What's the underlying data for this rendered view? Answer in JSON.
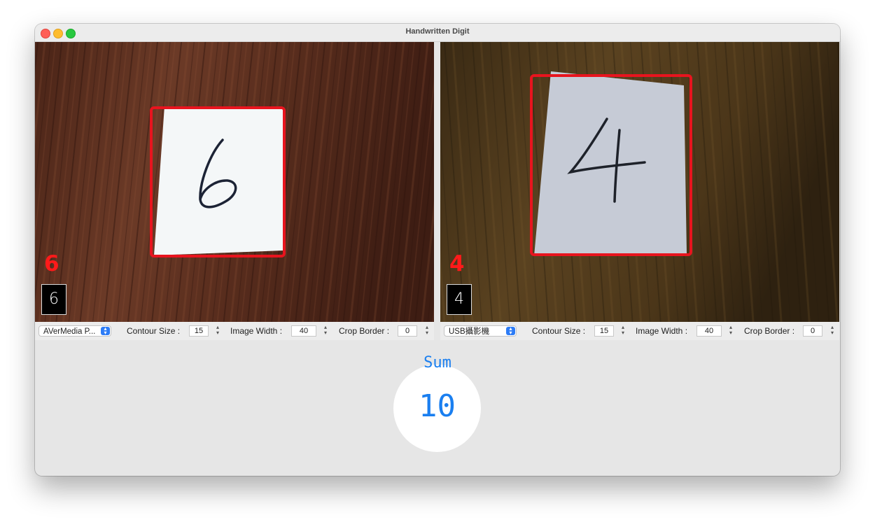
{
  "window": {
    "title": "Handwritten Digit"
  },
  "cameras": [
    {
      "prediction": "6",
      "thumbnail_digit": "6",
      "device": "AVerMedia P...",
      "contour_label": "Contour Size :",
      "contour_value": "15",
      "width_label": "Image Width :",
      "width_value": "40",
      "crop_label": "Crop Border :",
      "crop_value": "0"
    },
    {
      "prediction": "4",
      "thumbnail_digit": "4",
      "device": "USB攝影機",
      "contour_label": "Contour Size :",
      "contour_value": "15",
      "width_label": "Image Width :",
      "width_value": "40",
      "crop_label": "Crop Border :",
      "crop_value": "0"
    }
  ],
  "sum": {
    "label": "Sum",
    "value": "10"
  },
  "colors": {
    "accent": "#1a7ff0",
    "detection_box": "#e8141e",
    "prediction_text": "#ff1a1a"
  }
}
